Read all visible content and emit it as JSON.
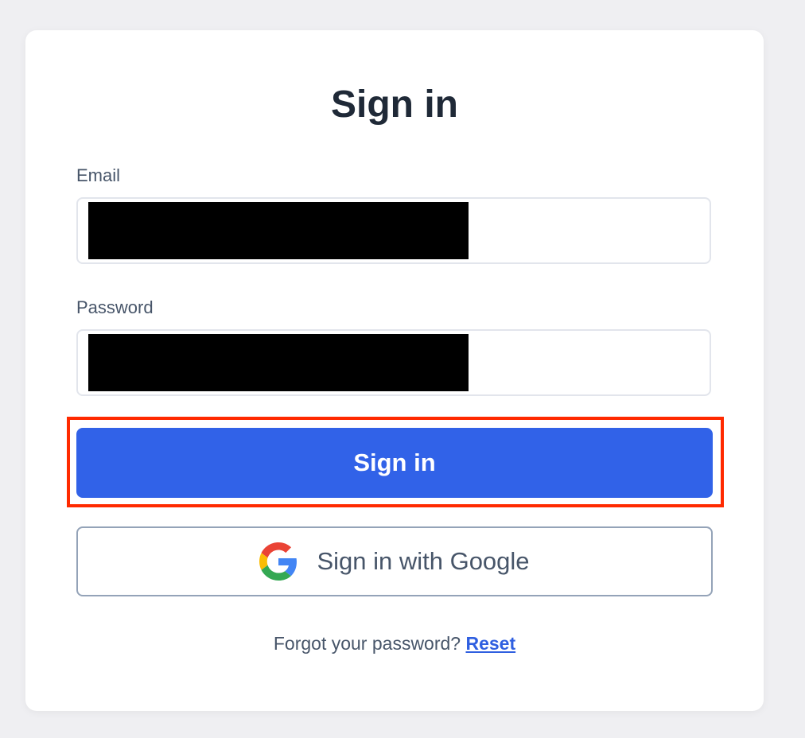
{
  "title": "Sign in",
  "form": {
    "email_label": "Email",
    "email_value": "",
    "password_label": "Password",
    "password_value": ""
  },
  "buttons": {
    "sign_in_label": "Sign in",
    "google_label": "Sign in with Google"
  },
  "footer": {
    "forgot_text": "Forgot your password?",
    "reset_link": "Reset"
  },
  "colors": {
    "background": "#efeff2",
    "card": "#ffffff",
    "primary": "#3162e8",
    "highlight": "#ff2a00",
    "text_dark": "#1f2937",
    "text_muted": "#475569"
  },
  "icons": {
    "google": "google-g-icon"
  }
}
